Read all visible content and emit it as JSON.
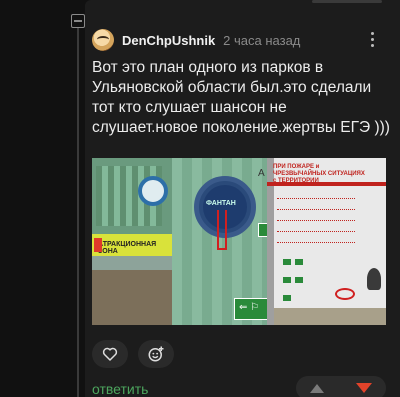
{
  "comment": {
    "username": "DenChpUshnik",
    "time": "2 часа назад",
    "text": "Вот это план одного из парков в Ульяновской области был.это сделали тот кто слушает шансон не слушает.новое поколение.жертвы ЕГЭ )))",
    "reply_label": "ответить",
    "rating": ""
  },
  "image": {
    "sign_title": "ПРИ ПОЖАРЕ и ЧРЕЗВЫЧАЙНЫХ СИТУАЦИЯХ с ТЕРРИТОРИИ",
    "center_label": "ФАНТАН",
    "zone_label": "АТРАКЦИОННАЯ ЗОНА",
    "letter": "А"
  },
  "icons": {
    "like": "heart-icon",
    "emoji": "emoji-add-icon",
    "menu": "more-vertical-icon",
    "upvote": "upvote-icon",
    "downvote": "downvote-icon"
  },
  "colors": {
    "background": "#111111",
    "card": "#1c1c1c",
    "accent_green": "#4da65e",
    "downvote": "#e2432a"
  }
}
